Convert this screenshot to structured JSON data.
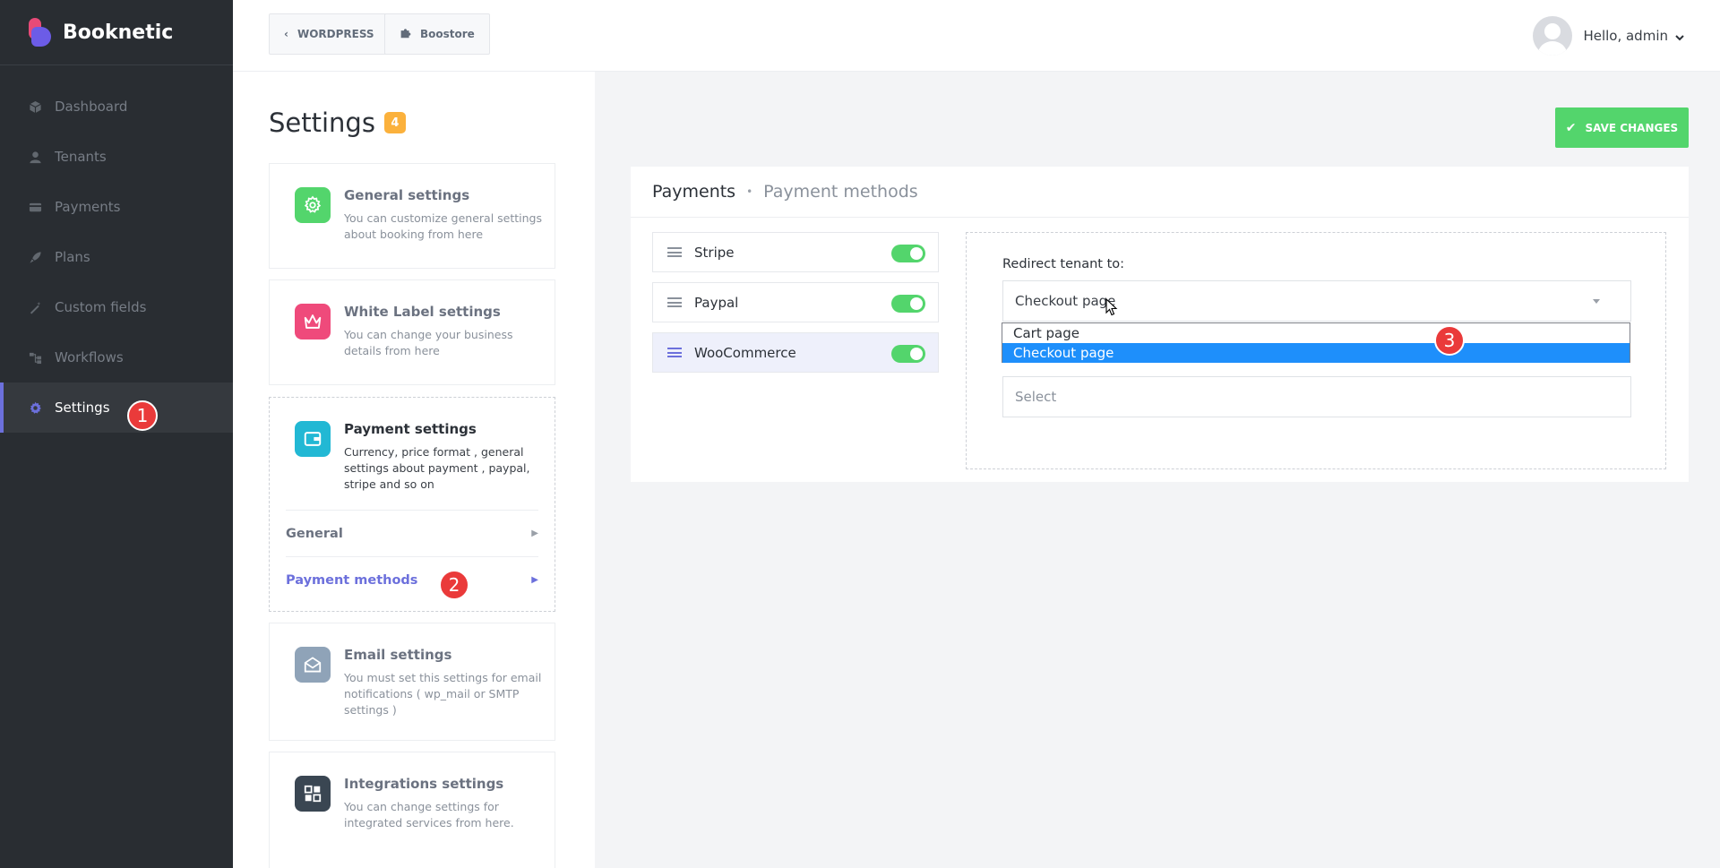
{
  "app": {
    "name": "Booknetic"
  },
  "sidebar": {
    "items": [
      {
        "label": "Dashboard",
        "icon": "cube-icon"
      },
      {
        "label": "Tenants",
        "icon": "user-icon"
      },
      {
        "label": "Payments",
        "icon": "credit-card-icon"
      },
      {
        "label": "Plans",
        "icon": "rocket-icon"
      },
      {
        "label": "Custom fields",
        "icon": "magic-wand-icon"
      },
      {
        "label": "Workflows",
        "icon": "workflow-icon"
      },
      {
        "label": "Settings",
        "icon": "gear-icon",
        "active": true
      }
    ]
  },
  "topbar": {
    "wordpress_label": "WORDPRESS",
    "boostore_label": "Boostore",
    "greeting": "Hello, admin"
  },
  "settings": {
    "title": "Settings",
    "count": "4",
    "cards": [
      {
        "title": "General settings",
        "desc": "You can customize general settings about booking from here",
        "color": "#53d56c",
        "icon": "gear-icon"
      },
      {
        "title": "White Label settings",
        "desc": "You can change your business details from here",
        "color": "#ef4a7b",
        "icon": "crown-icon"
      },
      {
        "title": "Payment settings",
        "desc": "Currency, price format , general settings about payment , paypal, stripe and so on",
        "color": "#22b8d4",
        "icon": "wallet-icon"
      },
      {
        "title": "Email settings",
        "desc": "You must set this settings for email notifications ( wp_mail or SMTP settings )",
        "color": "#8fa3b8",
        "icon": "envelope-icon"
      },
      {
        "title": "Integrations settings",
        "desc": "You can change settings for integrated services from here.",
        "color": "#3a4652",
        "icon": "integrations-icon"
      }
    ],
    "payment_subitems": [
      "General",
      "Payment methods"
    ]
  },
  "save_button": {
    "label": "SAVE CHANGES"
  },
  "panel": {
    "crumb_main": "Payments",
    "crumb_sub": "Payment methods",
    "methods": [
      {
        "name": "Stripe",
        "enabled": true
      },
      {
        "name": "Paypal",
        "enabled": true
      },
      {
        "name": "WooCommerce",
        "enabled": true,
        "selected": true
      }
    ],
    "redirect_label": "Redirect tenant to:",
    "redirect_value": "Checkout page",
    "dropdown_options": [
      "Cart page",
      "Checkout page"
    ],
    "status_placeholder": "Select"
  },
  "annotations": [
    "1",
    "2",
    "3"
  ]
}
